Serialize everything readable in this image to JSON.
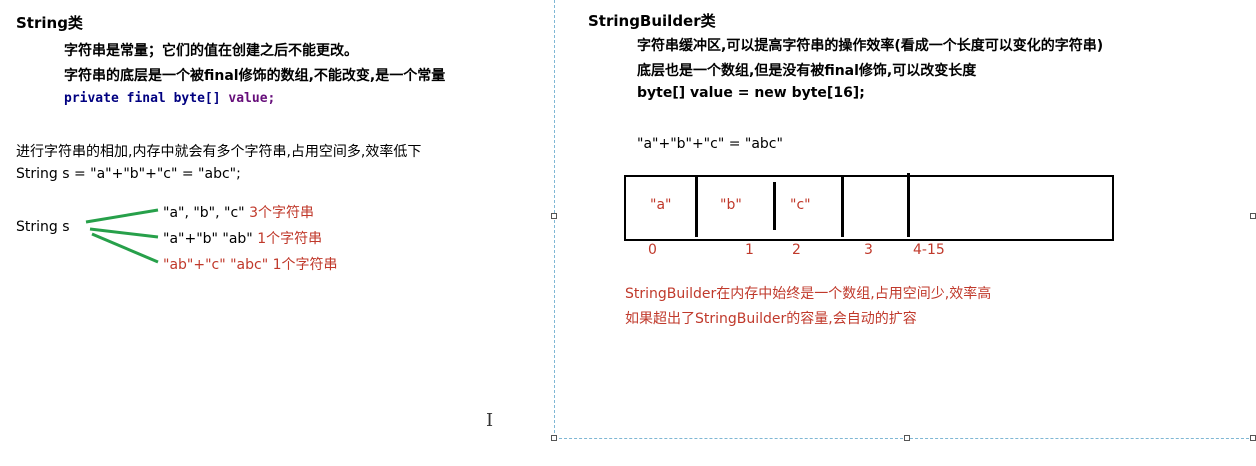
{
  "left": {
    "title": "String类",
    "line1": "字符串是常量；它们的值在创建之后不能更改。",
    "line2": "字符串的底层是一个被final修饰的数组,不能改变,是一个常量",
    "code": {
      "kw1": "private",
      "kw2": "final",
      "type": "byte[]",
      "var": "value;"
    },
    "concat_note": "进行字符串的相加,内存中就会有多个字符串,占用空间多,效率低下",
    "concat_code": "String s = \"a\"+\"b\"+\"c\" = \"abc\";",
    "diagram_label": "String s",
    "branches": [
      {
        "text": "\"a\", \"b\", \"c\"",
        "count": "3个字符串"
      },
      {
        "text": "\"a\"+\"b\"  \"ab\"",
        "count": "1个字符串"
      },
      {
        "text": "\"ab\"+\"c\" \"abc\" 1个字符串",
        "count": ""
      }
    ]
  },
  "right": {
    "title": "StringBuilder类",
    "line1": "字符串缓冲区,可以提高字符串的操作效率(看成一个长度可以变化的字符串)",
    "line2": "底层也是一个数组,但是没有被final修饰,可以改变长度",
    "line3": "byte[] value = new byte[16];",
    "concat_expr": "\"a\"+\"b\"+\"c\" = \"abc\"",
    "cells": [
      "\"a\"",
      "\"b\"",
      "\"c\"",
      "",
      ""
    ],
    "indices": [
      "0",
      "1",
      "2",
      "3",
      "4-15"
    ],
    "note1": "StringBuilder在内存中始终是一个数组,占用空间少,效率高",
    "note2": "如果超出了StringBuilder的容量,会自动的扩容"
  },
  "colors": {
    "red": "#c0392b",
    "green": "#27a04a",
    "guide": "#7fb7d4"
  }
}
